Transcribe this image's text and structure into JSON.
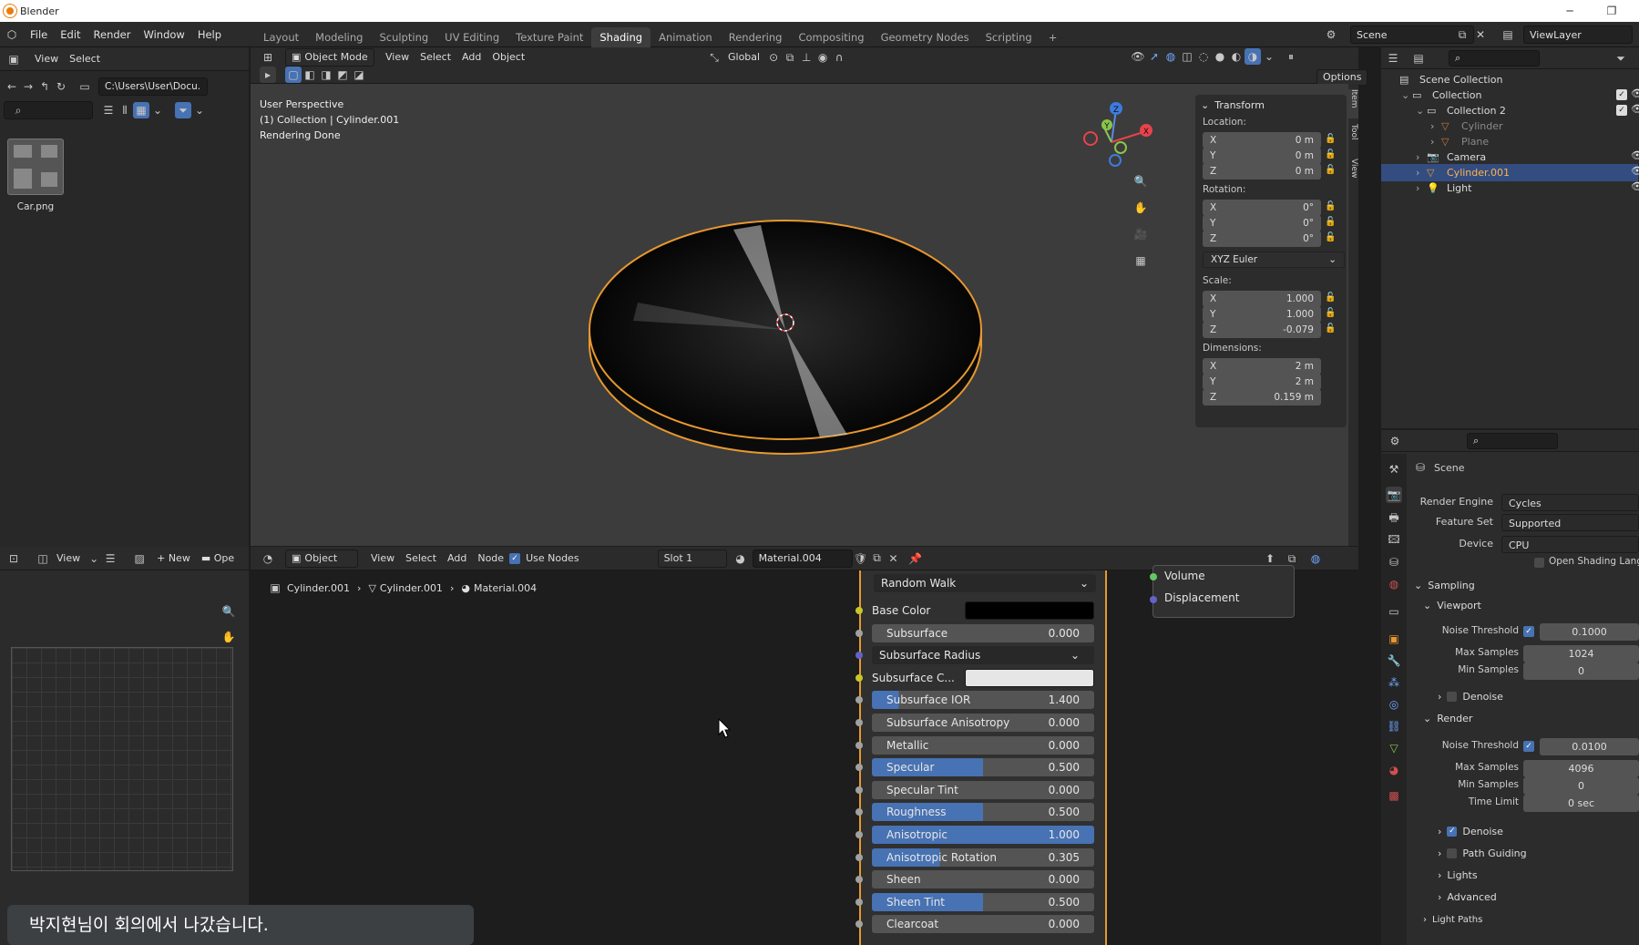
{
  "window": {
    "title": "Blender"
  },
  "menu": {
    "items": [
      "File",
      "Edit",
      "Render",
      "Window",
      "Help"
    ]
  },
  "workspaces": {
    "tabs": [
      "Layout",
      "Modeling",
      "Sculpting",
      "UV Editing",
      "Texture Paint",
      "Shading",
      "Animation",
      "Rendering",
      "Compositing",
      "Geometry Nodes",
      "Scripting"
    ],
    "active": "Shading",
    "add": "+"
  },
  "scene_field": {
    "value": "Scene"
  },
  "viewlayer_field": {
    "value": "ViewLayer"
  },
  "filebrowser": {
    "view": "View",
    "select": "Select",
    "path": "C:\\Users\\User\\Docu...",
    "file_name": "Car.png"
  },
  "viewport_header": {
    "mode": "Object Mode",
    "view": "View",
    "select": "Select",
    "add": "Add",
    "object": "Object",
    "orientation": "Global",
    "options": "Options"
  },
  "viewport": {
    "line1": "User Perspective",
    "line2": "(1) Collection | Cylinder.001",
    "line3": "Rendering Done",
    "side_tabs": [
      "Item",
      "Tool",
      "View"
    ]
  },
  "transform": {
    "title": "Transform",
    "location_label": "Location:",
    "location": [
      {
        "axis": "X",
        "value": "0 m"
      },
      {
        "axis": "Y",
        "value": "0 m"
      },
      {
        "axis": "Z",
        "value": "0 m"
      }
    ],
    "rotation_label": "Rotation:",
    "rotation": [
      {
        "axis": "X",
        "value": "0°"
      },
      {
        "axis": "Y",
        "value": "0°"
      },
      {
        "axis": "Z",
        "value": "0°"
      }
    ],
    "rotation_mode": "XYZ Euler",
    "scale_label": "Scale:",
    "scale": [
      {
        "axis": "X",
        "value": "1.000"
      },
      {
        "axis": "Y",
        "value": "1.000"
      },
      {
        "axis": "Z",
        "value": "-0.079"
      }
    ],
    "dimensions_label": "Dimensions:",
    "dimensions": [
      {
        "axis": "X",
        "value": "2 m"
      },
      {
        "axis": "Y",
        "value": "2 m"
      },
      {
        "axis": "Z",
        "value": "0.159 m"
      }
    ]
  },
  "outliner": {
    "rows": [
      {
        "label": "Scene Collection"
      },
      {
        "label": "Collection"
      },
      {
        "label": "Collection 2"
      },
      {
        "label": "Cylinder"
      },
      {
        "label": "Plane"
      },
      {
        "label": "Camera"
      },
      {
        "label": "Cylinder.001"
      },
      {
        "label": "Light"
      }
    ]
  },
  "properties": {
    "scene": "Scene",
    "render_engine_label": "Render Engine",
    "render_engine": "Cycles",
    "feature_set_label": "Feature Set",
    "feature_set": "Supported",
    "device_label": "Device",
    "device": "CPU",
    "osl": "Open Shading Language",
    "sampling": "Sampling",
    "viewport": "Viewport",
    "noise_threshold_label": "Noise Threshold",
    "vp_noise_threshold": "0.1000",
    "max_samples_label": "Max Samples",
    "vp_max_samples": "1024",
    "min_samples_label": "Min Samples",
    "vp_min_samples": "0",
    "denoise": "Denoise",
    "render": "Render",
    "r_noise_threshold": "0.0100",
    "r_max_samples": "4096",
    "r_min_samples": "0",
    "time_limit_label": "Time Limit",
    "time_limit": "0 sec",
    "path_guiding": "Path Guiding",
    "lights": "Lights",
    "advanced": "Advanced",
    "light_paths": "Light Paths"
  },
  "image_editor": {
    "view": "View",
    "new": "New",
    "open": "Ope"
  },
  "node_header": {
    "type": "Object",
    "view": "View",
    "select": "Select",
    "add": "Add",
    "node": "Node",
    "use_nodes": "Use Nodes",
    "slot": "Slot 1",
    "material": "Material.004"
  },
  "breadcrumb": [
    "Cylinder.001",
    "Cylinder.001",
    "Material.004"
  ],
  "output_node": {
    "volume": "Volume",
    "displacement": "Displacement"
  },
  "bsdf": {
    "subsurface_method": "Random Walk",
    "rows": [
      {
        "label": "Base Color",
        "value": "",
        "fill": 0,
        "kind": "color",
        "swatch": "#000000",
        "sock": "#c7c729"
      },
      {
        "label": "Subsurface",
        "value": "0.000",
        "fill": 0,
        "kind": "num",
        "sock": "#a1a1a1"
      },
      {
        "label": "Subsurface Radius",
        "value": "",
        "fill": 0,
        "kind": "dd",
        "sock": "#6363c7"
      },
      {
        "label": "Subsurface C...",
        "value": "",
        "fill": 0,
        "kind": "color",
        "swatch": "#e6e6e6",
        "sock": "#c7c729"
      },
      {
        "label": "Subsurface IOR",
        "value": "1.400",
        "fill": 0.12,
        "kind": "num",
        "sock": "#a1a1a1"
      },
      {
        "label": "Subsurface Anisotropy",
        "value": "0.000",
        "fill": 0,
        "kind": "num",
        "sock": "#a1a1a1"
      },
      {
        "label": "Metallic",
        "value": "0.000",
        "fill": 0,
        "kind": "num",
        "sock": "#a1a1a1"
      },
      {
        "label": "Specular",
        "value": "0.500",
        "fill": 0.5,
        "kind": "num",
        "sock": "#a1a1a1"
      },
      {
        "label": "Specular Tint",
        "value": "0.000",
        "fill": 0,
        "kind": "num",
        "sock": "#a1a1a1"
      },
      {
        "label": "Roughness",
        "value": "0.500",
        "fill": 0.5,
        "kind": "num",
        "sock": "#a1a1a1"
      },
      {
        "label": "Anisotropic",
        "value": "1.000",
        "fill": 1,
        "kind": "num",
        "sock": "#a1a1a1"
      },
      {
        "label": "Anisotropic Rotation",
        "value": "0.305",
        "fill": 0.305,
        "kind": "num",
        "sock": "#a1a1a1"
      },
      {
        "label": "Sheen",
        "value": "0.000",
        "fill": 0,
        "kind": "num",
        "sock": "#a1a1a1"
      },
      {
        "label": "Sheen Tint",
        "value": "0.500",
        "fill": 0.5,
        "kind": "num",
        "sock": "#a1a1a1"
      },
      {
        "label": "Clearcoat",
        "value": "0.000",
        "fill": 0,
        "kind": "num",
        "sock": "#a1a1a1"
      }
    ]
  },
  "toast": {
    "text": "박지현님이 회의에서 나갔습니다."
  },
  "colors": {
    "accent_blue": "#4772b3",
    "selection_orange": "#e8982e",
    "active_row": "#334d80"
  }
}
